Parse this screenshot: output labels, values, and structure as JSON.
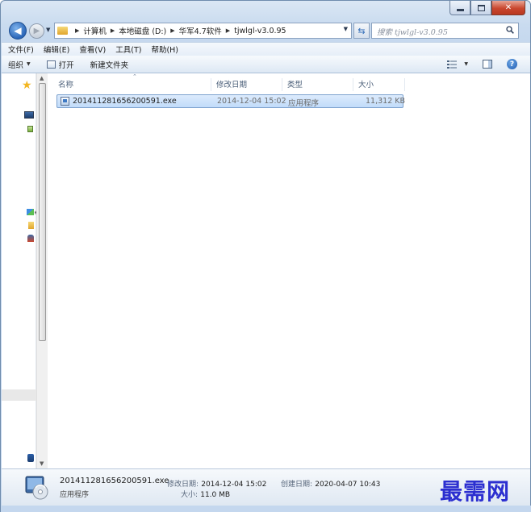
{
  "address": {
    "crumbs": [
      "计算机",
      "本地磁盘 (D:)",
      "华军4.7软件",
      "tjwlgl-v3.0.95"
    ]
  },
  "search": {
    "placeholder": "搜索 tjwlgl-v3.0.95"
  },
  "menu": {
    "items": [
      "文件(F)",
      "编辑(E)",
      "查看(V)",
      "工具(T)",
      "帮助(H)"
    ]
  },
  "commands": {
    "organize": "组织",
    "open": "打开",
    "new_folder": "新建文件夹",
    "help": "?"
  },
  "columns": {
    "name": "名称",
    "modified": "修改日期",
    "type": "类型",
    "size": "大小"
  },
  "files": [
    {
      "name": "201411281656200591.exe",
      "modified": "2014-12-04 15:02",
      "type": "应用程序",
      "size": "11,312 KB"
    }
  ],
  "details": {
    "name": "201411281656200591.exe",
    "type": "应用程序",
    "modified_label": "修改日期:",
    "modified_value": "2014-12-04 15:02",
    "size_label": "大小:",
    "size_value": "11.0 MB",
    "created_label": "创建日期:",
    "created_value": "2020-04-07 10:43"
  },
  "watermark": "最需网"
}
